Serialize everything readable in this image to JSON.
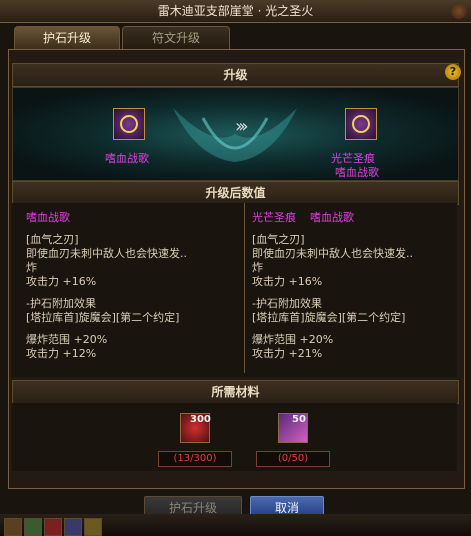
{
  "window": {
    "title": "雷木迪亚支部崖堂 · 光之圣火"
  },
  "tabs": [
    {
      "label": "护石升级"
    },
    {
      "label": "符文升级"
    }
  ],
  "upgrade": {
    "header": "升级",
    "help_icon": "?",
    "source_item": {
      "name": "嗜血战歌"
    },
    "target_item": {
      "name_line1": "光芒圣痕",
      "name_line2": "嗜血战歌"
    },
    "arrow_glyph": "›››"
  },
  "values": {
    "header": "升级后数值",
    "left": {
      "name": "嗜血战歌",
      "skill": "[血气之刃]",
      "desc1": "即使血刃未刺中敌人也会快速发..",
      "desc2": "炸",
      "atk": "攻击力 +16%",
      "set_header": "-护石附加效果",
      "set_name": "[塔拉库首]旋魔会][第二个约定]",
      "range": "爆炸范围 +20%",
      "atk2": "攻击力 +12%"
    },
    "right": {
      "name_part1": "光芒圣痕",
      "name_part2": "嗜血战歌",
      "skill": "[血气之刃]",
      "desc1": "即使血刃未刺中敌人也会快速发..",
      "desc2": "炸",
      "atk": "攻击力 +16%",
      "set_header": "-护石附加效果",
      "set_name": "[塔拉库首]旋魔会][第二个约定]",
      "range": "爆炸范围 +20%",
      "atk2": "攻击力 +21%"
    }
  },
  "materials": {
    "header": "所需材料",
    "items": [
      {
        "icon": "red-crystal-icon",
        "count": "300",
        "have": "(13/300)"
      },
      {
        "icon": "purple-shard-icon",
        "count": "50",
        "have": "(0/50)"
      }
    ]
  },
  "buttons": {
    "upgrade": "护石升级",
    "cancel": "取消"
  },
  "colors": {
    "magenta": "#e040e0",
    "cancel_blue": "#2a4a9a",
    "deficit_red": "#e04040"
  }
}
